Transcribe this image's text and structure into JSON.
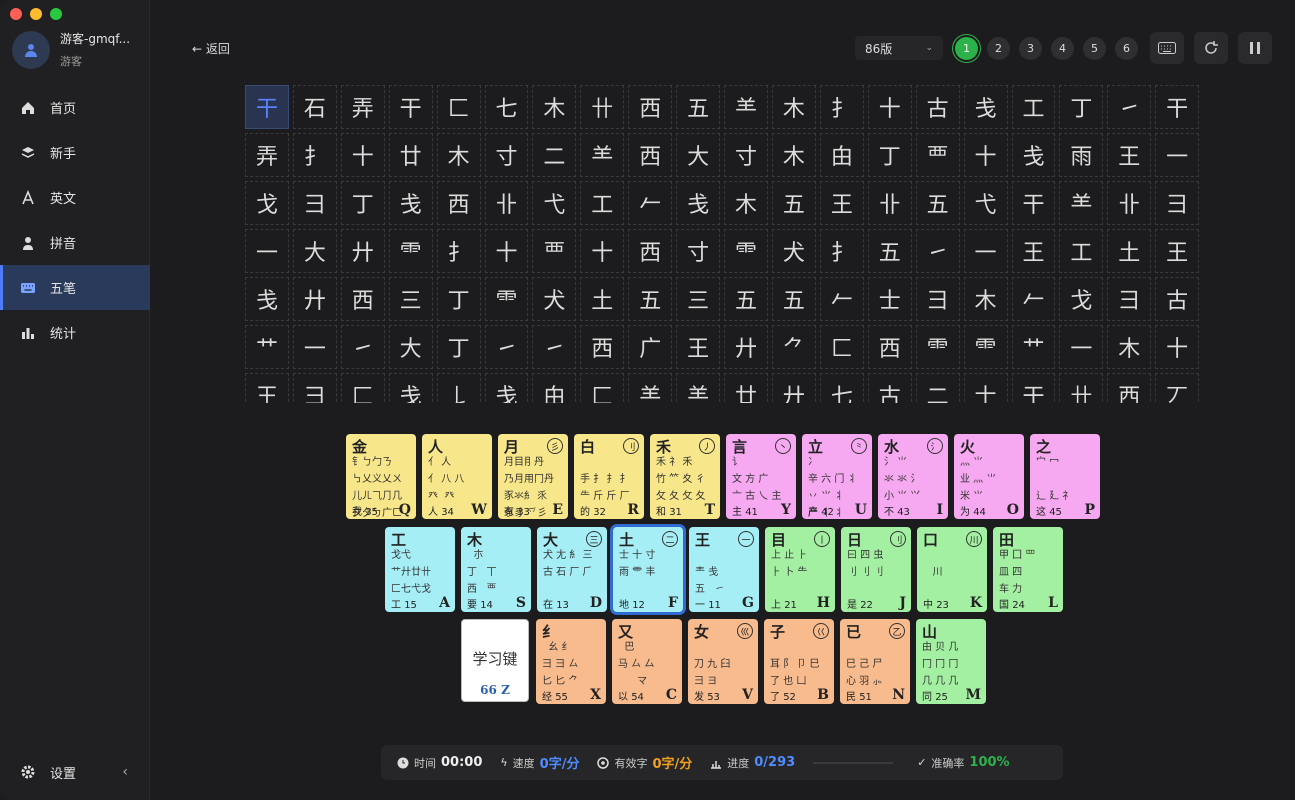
{
  "user": {
    "name": "游客-gmqf...",
    "role": "游客"
  },
  "nav": [
    {
      "label": "首页",
      "icon": "home-icon"
    },
    {
      "label": "新手",
      "icon": "layers-icon"
    },
    {
      "label": "英文",
      "icon": "letter-a-icon"
    },
    {
      "label": "拼音",
      "icon": "person-icon"
    },
    {
      "label": "五笔",
      "icon": "keyboard-icon",
      "active": true
    },
    {
      "label": "统计",
      "icon": "bar-chart-icon"
    }
  ],
  "settings_label": "设置",
  "back_label": "← 返回",
  "version": "86版",
  "levels": [
    "1",
    "2",
    "3",
    "4",
    "5",
    "6"
  ],
  "active_level": "1",
  "practice_rows": [
    [
      "干",
      "石",
      "弄",
      "干",
      "匚",
      "七",
      "木",
      "卄",
      "西",
      "五",
      "⺷",
      "木",
      "扌",
      "十",
      "古",
      "戋",
      "工",
      "丁",
      "㇀",
      "干"
    ],
    [
      "弄",
      "扌",
      "十",
      "廿",
      "木",
      "寸",
      "二",
      "⺷",
      "西",
      "大",
      "寸",
      "木",
      "甶",
      "丁",
      "覀",
      "十",
      "戋",
      "雨",
      "王",
      "一"
    ],
    [
      "戈",
      "⺕",
      "丁",
      "戋",
      "西",
      "卝",
      "弋",
      "工",
      "𠂉",
      "戋",
      "木",
      "五",
      "王",
      "卝",
      "五",
      "弋",
      "干",
      "⺷",
      "卝",
      "⺕"
    ],
    [
      "一",
      "大",
      "廾",
      "⻗",
      "扌",
      "十",
      "覀",
      "十",
      "西",
      "寸",
      "⻗",
      "犬",
      "扌",
      "五",
      "㇀",
      "一",
      "王",
      "工",
      "土",
      "王"
    ],
    [
      "戋",
      "廾",
      "西",
      "三",
      "丁",
      "⻗",
      "犬",
      "土",
      "五",
      "三",
      "五",
      "五",
      "𠂉",
      "士",
      "⺕",
      "木",
      "𠂉",
      "戈",
      "⺕",
      "古"
    ],
    [
      "艹",
      "一",
      "㇀",
      "大",
      "丁",
      "㇀",
      "㇀",
      "西",
      "广",
      "王",
      "廾",
      "⺈",
      "匚",
      "西",
      "⻗",
      "⻗",
      "艹",
      "一",
      "木",
      "十"
    ],
    [
      "王",
      "⺕",
      "匚",
      "戋",
      "𠄌",
      "戋",
      "甶",
      "匚",
      "⺷",
      "⺷",
      "廿",
      "廾",
      "七",
      "古",
      "二",
      "士",
      "干",
      "卄",
      "西",
      "丆"
    ]
  ],
  "keyboard": {
    "row1": [
      {
        "main": "金",
        "sub": "钅ㄅ勹ㄋ\n㇉乂义乂ㄨ\n儿ㄦ⺄⺆几\n夕夕ㄅ广ㄈ",
        "label": "我",
        "num": "35",
        "letter": "Q",
        "color": "y"
      },
      {
        "main": "人",
        "sub": "亻 人\n亻 八 八\n癶  癶",
        "label": "人",
        "num": "34",
        "letter": "W",
        "color": "y"
      },
      {
        "main": "月",
        "sub": "月目⺝丹\n乃月用冂丹\n豕氺⺯ 乑\n豕豸 乊彡",
        "label": "有",
        "num": "33",
        "letter": "E",
        "color": "y",
        "circle": "彡"
      },
      {
        "main": "白",
        "sub": "\n手 ⺘ 扌 扌\n⺧ 斤 斤 厂\n",
        "label": "的",
        "num": "32",
        "letter": "R",
        "color": "y",
        "circle": "⺉"
      },
      {
        "main": "禾",
        "sub": "禾 礻 禾\n竹 ⺮ 夊 彳\n攵 夂 攵 夂",
        "label": "和",
        "num": "31",
        "letter": "T",
        "color": "y",
        "circle": "丿"
      },
      {
        "main": "言",
        "sub": "讠 \n文 方 广\n亠 古 乀 主",
        "label": "主",
        "num": "41",
        "letter": "Y",
        "color": "m",
        "circle": "丶"
      },
      {
        "main": "立",
        "sub": "冫 \n辛 六 门 丬\n丷 ⺌ 丬\n产 丬 丬",
        "label": "产",
        "num": "42",
        "letter": "U",
        "color": "m",
        "circle": "⺀"
      },
      {
        "main": "水",
        "sub": "氵 ⺌\n氺 氺 氵\n小 ⺌ ⺍\n",
        "label": "不",
        "num": "43",
        "letter": "I",
        "color": "m",
        "circle": "氵"
      },
      {
        "main": "火",
        "sub": "灬 ⺌\n业 灬 ⺌\n米 ⺌",
        "label": "为",
        "num": "44",
        "letter": "O",
        "color": "m"
      },
      {
        "main": "之",
        "sub": "宀 冖\n\n辶 廴 礻",
        "label": "这",
        "num": "45",
        "letter": "P",
        "color": "m"
      }
    ],
    "row2": [
      {
        "main": "工",
        "sub": "戈弋\n艹廾廿卄\n匚七弋戈",
        "label": "工",
        "num": "15",
        "letter": "A",
        "color": "c"
      },
      {
        "main": "木",
        "sub": "  朩\n丁   丅\n西   覀",
        "label": "要",
        "num": "14",
        "letter": "S",
        "color": "c"
      },
      {
        "main": "大",
        "sub": "犬 尢 ⺯ 三\n古 石 厂 ⺁",
        "label": "在",
        "num": "13",
        "letter": "D",
        "color": "c",
        "circle": "三"
      },
      {
        "main": "土",
        "sub": "士 十 寸 \n雨 ⻗ 丰",
        "label": "地",
        "num": "12",
        "letter": "F",
        "color": "c",
        "circle": "二",
        "sel": true
      },
      {
        "main": "王",
        "sub": "  \n龶 戋\n五   ㇀",
        "label": "一",
        "num": "11",
        "letter": "G",
        "color": "c",
        "circle": "一"
      },
      {
        "main": "目",
        "sub": "上 止 ⺊\n⺊ 卜 ⺧\n",
        "label": "上",
        "num": "21",
        "letter": "H",
        "color": "g",
        "circle": "丨"
      },
      {
        "main": "日",
        "sub": "曰 四 虫\n刂 刂 刂",
        "label": "是",
        "num": "22",
        "letter": "J",
        "color": "g",
        "circle": "刂"
      },
      {
        "main": "口",
        "sub": "\n   川",
        "label": "中",
        "num": "23",
        "letter": "K",
        "color": "g",
        "circle": "川"
      },
      {
        "main": "田",
        "sub": "甲 囗 罒\n皿 四\n车 力",
        "label": "国",
        "num": "24",
        "letter": "L",
        "color": "g"
      }
    ],
    "row3": [
      {
        "main": "纟",
        "sub": "  幺 纟\n彐 彐 ㄙ\n匕 匕 ⺈",
        "label": "经",
        "num": "55",
        "letter": "X",
        "color": "o"
      },
      {
        "main": "又",
        "sub": "  巴\n马 ㄙ 厶\n      マ",
        "label": "以",
        "num": "54",
        "letter": "C",
        "color": "o"
      },
      {
        "main": "女",
        "sub": "\n刀 九 臼\n彐 ヨ",
        "label": "发",
        "num": "53",
        "letter": "V",
        "color": "o",
        "circle": "巛"
      },
      {
        "main": "子",
        "sub": "\n耳 阝 卩 巳\n了 也 凵",
        "label": "了",
        "num": "52",
        "letter": "B",
        "color": "o",
        "circle": "巜"
      },
      {
        "main": "已",
        "sub": "\n巳 己 尸\n心 羽 ⺗",
        "label": "民",
        "num": "51",
        "letter": "N",
        "color": "o",
        "circle": "乙"
      },
      {
        "main": "山",
        "sub": "由 贝 几\n冂 冂 冂\n几 几 几",
        "label": "同",
        "num": "25",
        "letter": "M",
        "color": "g"
      }
    ],
    "learn_key": {
      "text": "学习键",
      "num": "66",
      "letter": "Z"
    }
  },
  "status": {
    "time_label": "时间",
    "time": "00:00",
    "speed_label": "速度",
    "speed": "0字/分",
    "valid_label": "有效字",
    "valid": "0字/分",
    "progress_label": "进度",
    "progress": "0/293",
    "accuracy_label": "准确率",
    "accuracy": "100%"
  },
  "colors": {
    "accent": "#4f7cff",
    "green": "#2bb34a",
    "orange": "#f0a020",
    "blue": "#4f8cff"
  }
}
